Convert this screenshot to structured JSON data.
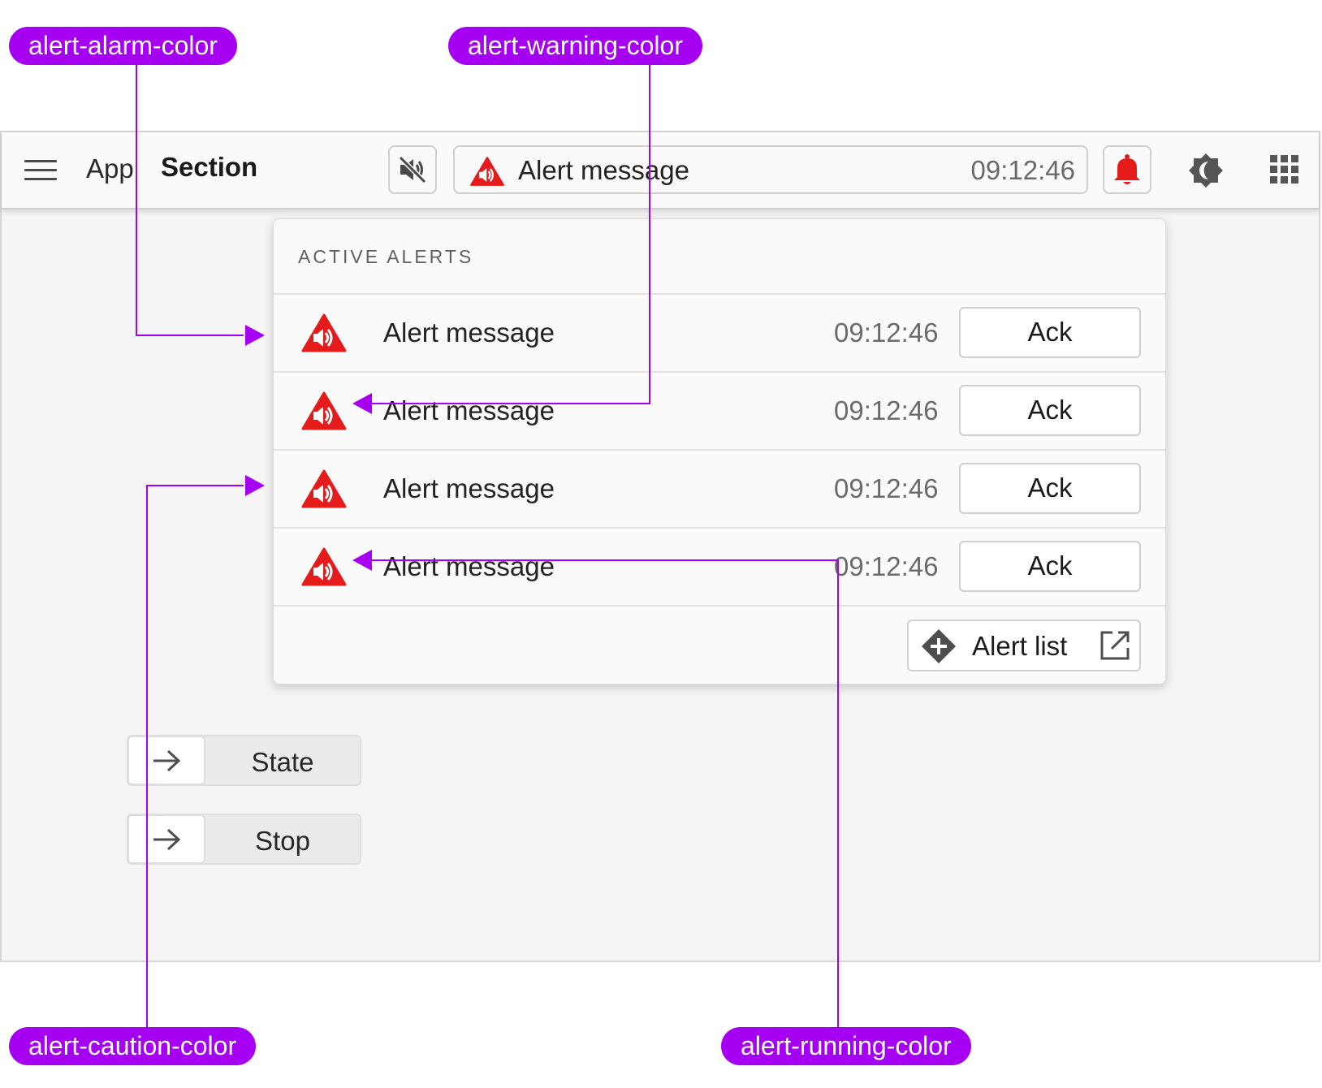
{
  "annotations": {
    "alarm": "alert-alarm-color",
    "warning": "alert-warning-color",
    "caution": "alert-caution-color",
    "running": "alert-running-color",
    "color": "#a600f2"
  },
  "topbar": {
    "menu_icon": "hamburger-menu-icon",
    "app": "App",
    "section": "Section",
    "mute_icon": "volume-off-icon",
    "alert": {
      "message": "Alert message",
      "time": "09:12:46",
      "icon": "alarm-triangle-icon"
    },
    "bell_icon": "bell-icon",
    "theme_icon": "brightness-icon",
    "apps_icon": "apps-grid-icon"
  },
  "panel": {
    "title": "ACTIVE ALERTS",
    "alerts": [
      {
        "message": "Alert message",
        "time": "09:12:46",
        "ack": "Ack"
      },
      {
        "message": "Alert message",
        "time": "09:12:46",
        "ack": "Ack"
      },
      {
        "message": "Alert message",
        "time": "09:12:46",
        "ack": "Ack"
      },
      {
        "message": "Alert message",
        "time": "09:12:46",
        "ack": "Ack"
      }
    ],
    "alert_list_button": "Alert list"
  },
  "controls": {
    "state": "State",
    "stop": "Stop"
  },
  "colors": {
    "alarm_red": "#e31b1b",
    "accent_purple": "#a600f2",
    "text_gray": "#6a6a6a"
  }
}
